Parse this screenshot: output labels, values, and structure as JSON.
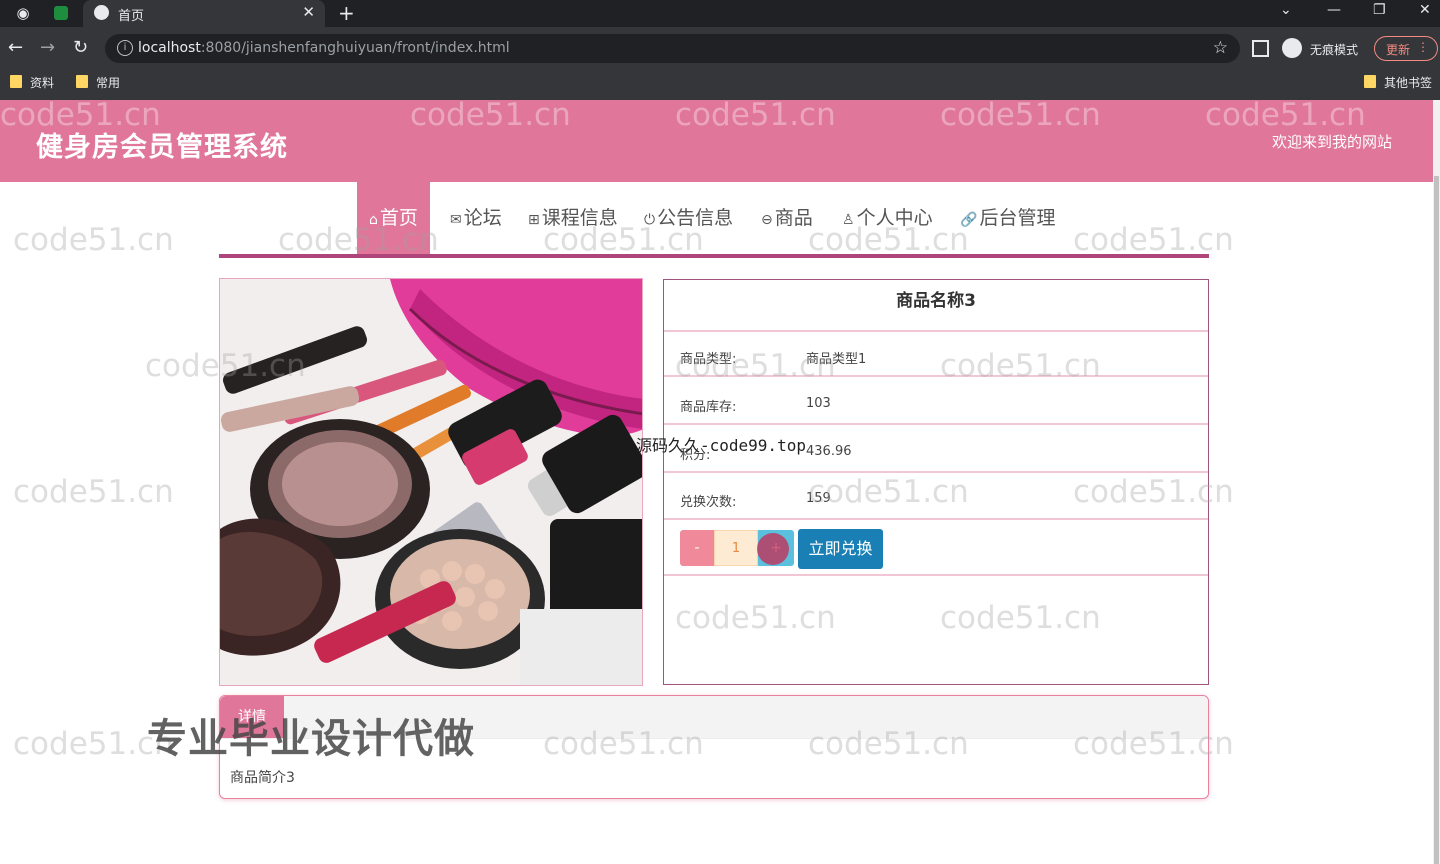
{
  "browser": {
    "tab_title": "首页",
    "url_host": "localhost",
    "url_rest": ":8080/jianshenfanghuiyuan/front/index.html",
    "incognito_label": "无痕模式",
    "update_label": "更新",
    "bookmarks": [
      "资料",
      "常用"
    ],
    "other_bookmarks": "其他书签"
  },
  "header": {
    "site_title": "健身房会员管理系统",
    "welcome": "欢迎来到我的网站"
  },
  "nav": [
    {
      "label": "首页",
      "icon": "⌂",
      "active": true
    },
    {
      "label": "论坛",
      "icon": "✉"
    },
    {
      "label": "课程信息",
      "icon": "⊞"
    },
    {
      "label": "公告信息",
      "icon": "⏻"
    },
    {
      "label": "商品",
      "icon": "⊖"
    },
    {
      "label": "个人中心",
      "icon": "♙"
    },
    {
      "label": "后台管理",
      "icon": "🔗"
    }
  ],
  "product": {
    "name": "商品名称3",
    "fields": [
      {
        "key": "商品类型:",
        "value": "商品类型1"
      },
      {
        "key": "商品库存:",
        "value": "103"
      },
      {
        "key": "积分:",
        "value": "436.96"
      },
      {
        "key": "兑换次数:",
        "value": "159"
      }
    ],
    "quantity": "1",
    "minus_label": "-",
    "plus_label": "+",
    "redeem_label": "立即兑换",
    "intro_tab": "详情",
    "intro_text": "商品简介3"
  },
  "overlays": {
    "code_site": "源码久久-code99.top",
    "ad_text": "专业毕业设计代做",
    "watermark": "code51.cn"
  },
  "colors": {
    "brand_pink": "#e0779b",
    "nav_underline": "#b0457c",
    "redeem_blue": "#1a7fb5"
  }
}
